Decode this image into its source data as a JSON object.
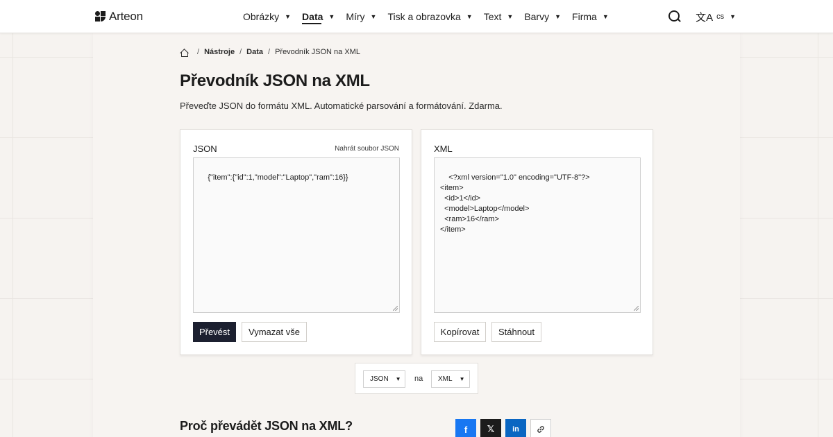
{
  "header": {
    "brand": "Arteon",
    "nav": [
      {
        "label": "Obrázky",
        "active": false
      },
      {
        "label": "Data",
        "active": true
      },
      {
        "label": "Míry",
        "active": false
      },
      {
        "label": "Tisk a obrazovka",
        "active": false
      },
      {
        "label": "Text",
        "active": false
      },
      {
        "label": "Barvy",
        "active": false
      },
      {
        "label": "Firma",
        "active": false
      }
    ],
    "caret": "▼",
    "language": "cs",
    "language_icon": "translate-icon",
    "search_icon": "search-icon"
  },
  "breadcrumb": {
    "home_icon": "home-icon",
    "sep": "/",
    "items": [
      "Nástroje",
      "Data",
      "Převodník JSON na XML"
    ]
  },
  "page": {
    "title": "Převodník JSON na XML",
    "subtitle": "Převeďte JSON do formátu XML. Automatické parsování a formátování. Zdarma."
  },
  "input_panel": {
    "label": "JSON",
    "upload_link": "Nahrát soubor JSON",
    "value": "{\"item\":{\"id\":1,\"model\":\"Laptop\",\"ram\":16}}",
    "convert_label": "Převést",
    "clear_label": "Vymazat vše"
  },
  "output_panel": {
    "label": "XML",
    "value": "<?xml version=\"1.0\" encoding=\"UTF-8\"?>\n<item>\n  <id>1</id>\n  <model>Laptop</model>\n  <ram>16</ram>\n</item>",
    "copy_label": "Kopírovat",
    "download_label": "Stáhnout"
  },
  "format_select": {
    "from": "JSON",
    "to_word": "na",
    "to": "XML"
  },
  "section": {
    "why_title": "Proč převádět JSON na XML?"
  },
  "share": {
    "facebook": "f",
    "x": "𝕏",
    "linkedin": "in",
    "link_icon": "link-icon"
  },
  "colors": {
    "primary_button": "#1c2030",
    "facebook": "#1877f2",
    "linkedin": "#0a66c2",
    "background": "#f6f3f0"
  }
}
